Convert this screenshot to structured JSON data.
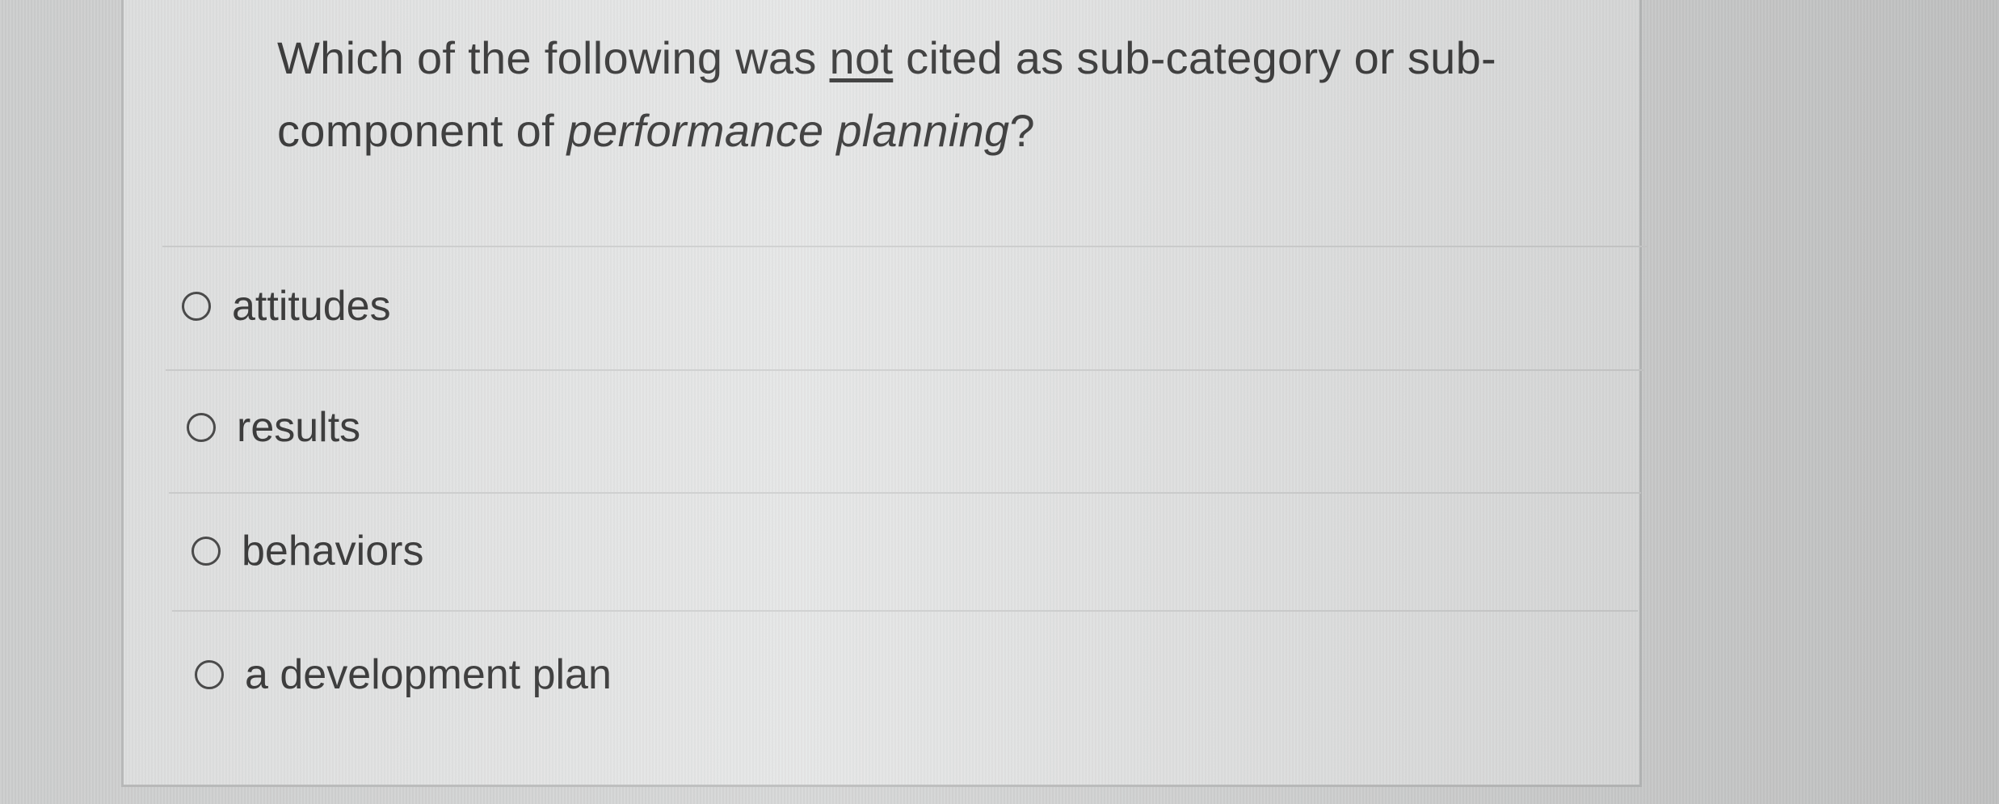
{
  "question": {
    "part1": "Which of the following was ",
    "emphasis": "not",
    "part2": " cited as sub-category or sub-component of ",
    "italic": "performance planning",
    "part3": "?"
  },
  "options": [
    {
      "label": "attitudes",
      "selected": false
    },
    {
      "label": "results",
      "selected": false
    },
    {
      "label": "behaviors",
      "selected": false
    },
    {
      "label": "a development plan",
      "selected": false
    }
  ],
  "colors": {
    "background": "#d5d6d6",
    "card": "#e4e5e5",
    "text": "#3b3b3b",
    "divider": "#cfd0d0"
  }
}
